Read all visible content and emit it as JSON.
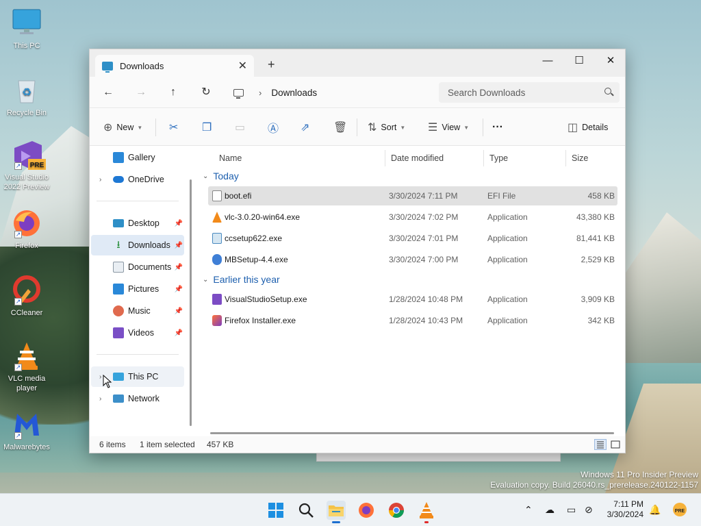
{
  "desktop": {
    "icons": [
      {
        "label": "This PC",
        "icon": "monitor-icon"
      },
      {
        "label": "Recycle Bin",
        "icon": "recycle-bin-icon"
      },
      {
        "label": "Visual Studio 2022 Preview",
        "icon": "visual-studio-icon",
        "badge": "PRE"
      },
      {
        "label": "Firefox",
        "icon": "firefox-icon"
      },
      {
        "label": "CCleaner",
        "icon": "ccleaner-icon"
      },
      {
        "label": "VLC media player",
        "icon": "vlc-icon"
      },
      {
        "label": "Malwarebytes",
        "icon": "malwarebytes-icon"
      }
    ],
    "watermark": {
      "line1": "Windows 11 Pro Insider Preview",
      "line2": "Evaluation copy. Build 26040.rs_prerelease.240122-1157"
    }
  },
  "window": {
    "tab_title": "Downloads",
    "new_tab_glyph": "+",
    "controls": {
      "minimize": "—",
      "maximize": "☐",
      "close": "✕"
    },
    "address": {
      "breadcrumb": "Downloads",
      "search_placeholder": "Search Downloads"
    },
    "toolbar": {
      "new_label": "New",
      "sort_label": "Sort",
      "view_label": "View",
      "more_label": "···",
      "details_label": "Details"
    },
    "nav_pane": {
      "gallery": "Gallery",
      "onedrive": "OneDrive",
      "desktop": "Desktop",
      "downloads": "Downloads",
      "documents": "Documents",
      "pictures": "Pictures",
      "music": "Music",
      "videos": "Videos",
      "this_pc": "This PC",
      "network": "Network"
    },
    "columns": {
      "name": "Name",
      "date": "Date modified",
      "type": "Type",
      "size": "Size"
    },
    "groups": [
      {
        "label": "Today",
        "files": [
          {
            "name": "boot.efi",
            "date": "3/30/2024 7:11 PM",
            "type": "EFI File",
            "size": "458 KB",
            "icon": "blank-file-icon"
          },
          {
            "name": "vlc-3.0.20-win64.exe",
            "date": "3/30/2024 7:02 PM",
            "type": "Application",
            "size": "43,380 KB",
            "icon": "vlc-installer-icon"
          },
          {
            "name": "ccsetup622.exe",
            "date": "3/30/2024 7:01 PM",
            "type": "Application",
            "size": "81,441 KB",
            "icon": "ccleaner-installer-icon"
          },
          {
            "name": "MBSetup-4.4.exe",
            "date": "3/30/2024 7:00 PM",
            "type": "Application",
            "size": "2,529 KB",
            "icon": "malwarebytes-installer-icon"
          }
        ]
      },
      {
        "label": "Earlier this year",
        "files": [
          {
            "name": "VisualStudioSetup.exe",
            "date": "1/28/2024 10:48 PM",
            "type": "Application",
            "size": "3,909 KB",
            "icon": "visual-studio-installer-icon"
          },
          {
            "name": "Firefox Installer.exe",
            "date": "1/28/2024 10:43 PM",
            "type": "Application",
            "size": "342 KB",
            "icon": "firefox-installer-icon"
          }
        ]
      }
    ],
    "status": {
      "items": "6 items",
      "selection": "1 item selected",
      "selection_size": "457 KB"
    }
  },
  "taskbar": {
    "clock_time": "7:11 PM",
    "clock_date": "3/30/2024"
  },
  "colors": {
    "accent": "#2e6fbe",
    "selection": "#e0eaf6",
    "group_header": "#1d5fae"
  }
}
